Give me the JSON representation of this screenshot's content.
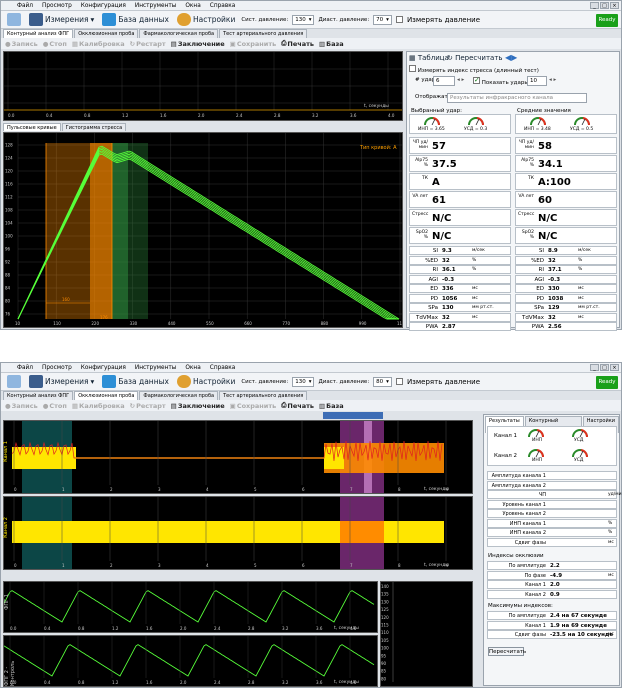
{
  "menu": [
    "Файл",
    "Просмотр",
    "Конфигурация",
    "Инструменты",
    "Окна",
    "Справка"
  ],
  "toolbar": {
    "measurements": "Измерения",
    "database": "База данных",
    "settings": "Настройки",
    "sys_label": "Сист. давление:",
    "sys_val_1": "130",
    "dia_label": "Диаст. давление:",
    "dia_val_1": "70",
    "sys_val_2": "130",
    "dia_val_2": "80",
    "measure": "Измерять давление",
    "ready": "Ready"
  },
  "tabs1": [
    "Контурный анализ ФПГ",
    "Окклюзионная проба",
    "Фармакологическая проба",
    "Тест артериального давления"
  ],
  "tabs2": [
    "Контурный анализ ФПГ",
    "Окклюзионная проба",
    "Фармакологическая проба",
    "Тест артериального давления"
  ],
  "actions": {
    "record": "Запись",
    "stop": "Стоп",
    "calib": "Калибровка",
    "restart": "Рестарт",
    "conclusion": "Заключение",
    "save": "Сохранить",
    "print": "Печать",
    "base": "База"
  },
  "w1": {
    "top_plot_xlabel": "t, секунды",
    "top_ticks": [
      "0.0",
      "0.4",
      "0.8",
      "1.2",
      "1.6",
      "2.0",
      "2.4",
      "2.8",
      "3.2",
      "3.6",
      "4.0"
    ],
    "subtabs": [
      "Пульсовые кривые",
      "Гистограмма стресса"
    ],
    "curve_type": "Тип кривой: A",
    "y_ticks": [
      "128",
      "124",
      "120",
      "116",
      "112",
      "108",
      "104",
      "100",
      "96",
      "92",
      "88",
      "84",
      "80",
      "76"
    ],
    "x_ticks": [
      "10",
      "110",
      "220",
      "330",
      "440",
      "550",
      "660",
      "770",
      "880",
      "990",
      "1100"
    ],
    "seg_labels": [
      "160",
      "176"
    ],
    "panel": {
      "table_label": "Таблица",
      "recalc": "Пересчитать",
      "stress_chk": "Измерять индекс стресса (длинный тест)",
      "beats_label": "# удара:",
      "beats_val": "6",
      "show_beats": "Показать удары:",
      "show_val": "10",
      "display_label": "Отображать:",
      "display_val": "Результаты инфракрасного канала",
      "selected_beat": "Выбранный удар:",
      "averages": "Средние значения",
      "inp_sel": "ИНП = 3.65",
      "usd_sel": "УСД = 0.3",
      "inp_avg": "ИНП = 3.48",
      "usd_avg": "УСД = 0.5",
      "rows_left": [
        {
          "l": "ЧП уд/мин",
          "v": "57"
        },
        {
          "l": "Alp75 %",
          "v": "37.5"
        },
        {
          "l": "ТК",
          "v": "A"
        },
        {
          "l": "VA лет",
          "v": "61"
        },
        {
          "l": "Стресс",
          "v": "N/C"
        },
        {
          "l": "SpO2 %",
          "v": "N/C"
        }
      ],
      "rows_right": [
        {
          "l": "ЧП уд/мин",
          "v": "58"
        },
        {
          "l": "Alp75 %",
          "v": "34.1"
        },
        {
          "l": "ТК",
          "v": "A:100"
        },
        {
          "l": "VA лет",
          "v": "60"
        },
        {
          "l": "Стресс",
          "v": "N/C"
        },
        {
          "l": "SpO2 %",
          "v": "N/C"
        }
      ],
      "params_left": [
        {
          "l": "SI",
          "v": "9.3",
          "u": "м/сек"
        },
        {
          "l": "%ED",
          "v": "32",
          "u": "%"
        },
        {
          "l": "RI",
          "v": "36.1",
          "u": "%"
        },
        {
          "l": "AGI",
          "v": "-0.3",
          "u": ""
        },
        {
          "l": "ED",
          "v": "336",
          "u": "мс"
        },
        {
          "l": "PD",
          "v": "1056",
          "u": "мс"
        },
        {
          "l": "SPa",
          "v": "130",
          "u": "мм рт.ст."
        },
        {
          "l": "TdVMax",
          "v": "32",
          "u": "мс"
        },
        {
          "l": "PWA",
          "v": "2.87",
          "u": ""
        }
      ],
      "params_right": [
        {
          "l": "SI",
          "v": "8.9",
          "u": "м/сек"
        },
        {
          "l": "%ED",
          "v": "32",
          "u": "%"
        },
        {
          "l": "RI",
          "v": "37.1",
          "u": "%"
        },
        {
          "l": "AGI",
          "v": "-0.3",
          "u": ""
        },
        {
          "l": "ED",
          "v": "330",
          "u": "мс"
        },
        {
          "l": "PD",
          "v": "1038",
          "u": "мс"
        },
        {
          "l": "SPa",
          "v": "129",
          "u": "мм рт.ст."
        },
        {
          "l": "TdVMax",
          "v": "32",
          "u": "мс"
        },
        {
          "l": "PWA",
          "v": "2.56",
          "u": ""
        }
      ]
    }
  },
  "w2": {
    "ch1_label": "Канал 1",
    "ch2_label": "Канал 2",
    "fpg1": "ФПГ 1",
    "fpg2": "ФПГ 2 - Контроль",
    "xlabel": "t, секунды",
    "ticks_long": [
      "0",
      "1",
      "2",
      "3",
      "4",
      "5",
      "6",
      "7",
      "8",
      "9"
    ],
    "ticks_short": [
      "0.0",
      "0.4",
      "0.8",
      "1.2",
      "1.6",
      "2.0",
      "2.4",
      "2.8",
      "3.2",
      "3.6",
      "4.0"
    ],
    "side_ticks": [
      "140",
      "135",
      "130",
      "125",
      "120",
      "115",
      "110",
      "105",
      "100",
      "95",
      "90",
      "85",
      "80"
    ],
    "panel": {
      "tabs": [
        "Результаты",
        "Контурный анализ",
        "Настройки"
      ],
      "ch1": "Канал 1",
      "ch2": "Канал 2",
      "inp": "ИНП",
      "usd": "УСД",
      "rows": [
        {
          "l": "Амплитуда канала 1",
          "v": "",
          "u": ""
        },
        {
          "l": "Амплитуда канала 2",
          "v": "",
          "u": ""
        },
        {
          "l": "ЧП",
          "v": "",
          "u": "уд/мин"
        },
        {
          "l": "Уровень канал 1",
          "v": "",
          "u": ""
        },
        {
          "l": "Уровень канал 2",
          "v": "",
          "u": ""
        },
        {
          "l": "ИНП канала 1",
          "v": "",
          "u": "%"
        },
        {
          "l": "ИНП канала 2",
          "v": "",
          "u": "%"
        },
        {
          "l": "Сдвиг фазы",
          "v": "",
          "u": "мс"
        }
      ],
      "occl_title": "Индексы окклюзии",
      "occl": [
        {
          "l": "По амплитуде",
          "v": "2.2",
          "u": ""
        },
        {
          "l": "По фазе",
          "v": "-4.9",
          "u": "мс"
        },
        {
          "l": "Канал 1",
          "v": "2.0",
          "u": ""
        },
        {
          "l": "Канал 2",
          "v": "0.9",
          "u": ""
        }
      ],
      "max_title": "Максимумы индексов:",
      "max": [
        {
          "l": "По амплитуде",
          "v": "2.4 на 67 секунде",
          "u": ""
        },
        {
          "l": "Канал 1",
          "v": "1.9 на 69 секунде",
          "u": ""
        },
        {
          "l": "Сдвиг фазы",
          "v": "-23.5 на 10 секунде",
          "u": "мс"
        }
      ],
      "recalc": "Пересчитать"
    }
  },
  "colors": {
    "accent": "#2f6fbf",
    "curve": "#57ff3a",
    "orange": "#ff8c00",
    "green_band": "#2e8b3d",
    "yellow": "#ffe600",
    "teal": "#1a9c9c",
    "magenta": "#b040b0",
    "ready": "#1aa01a"
  }
}
